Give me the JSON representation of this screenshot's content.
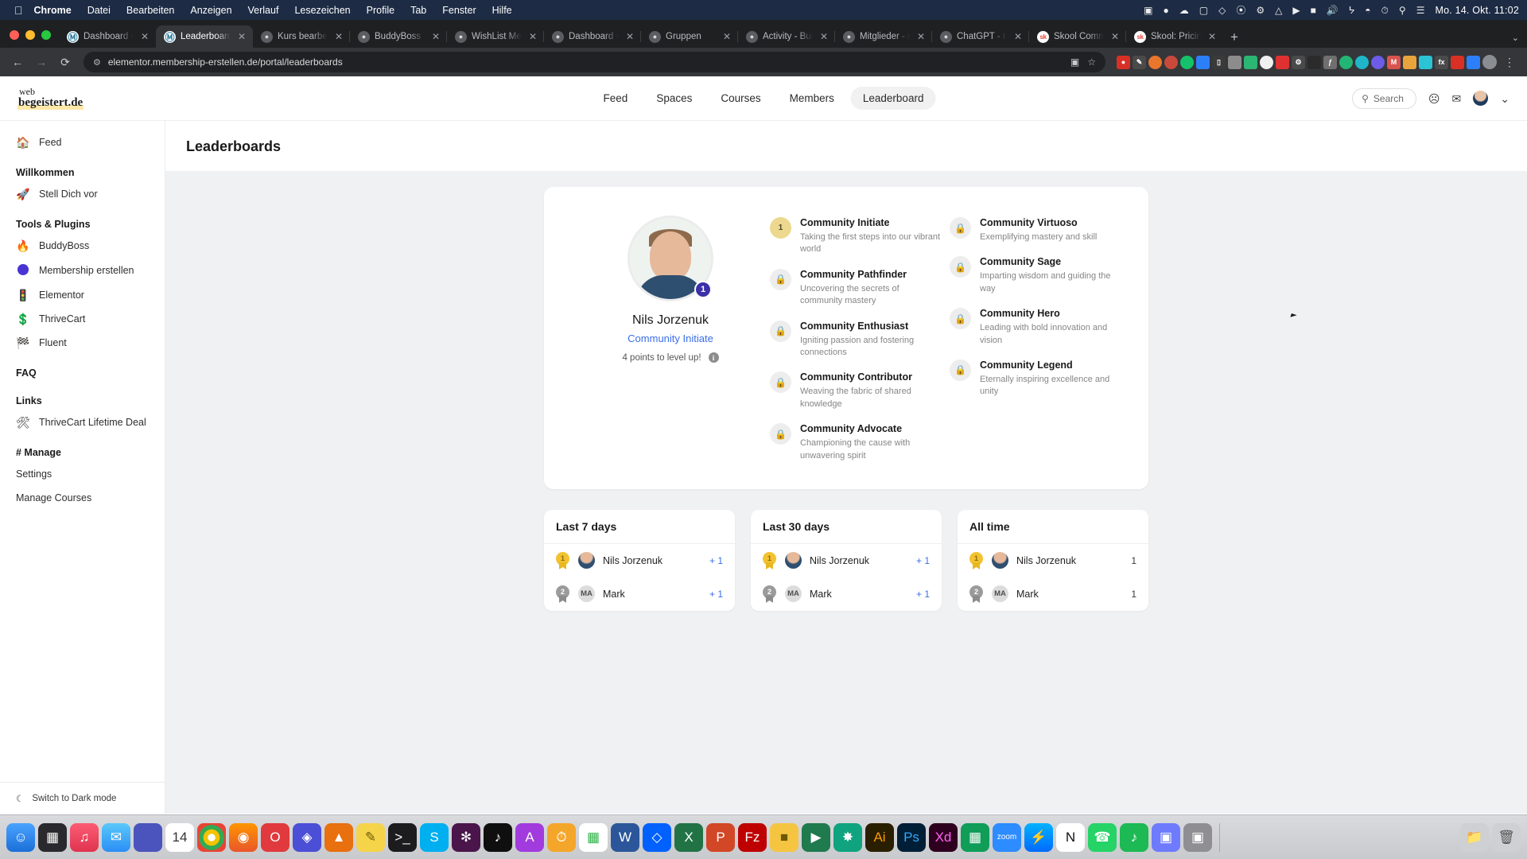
{
  "menubar": {
    "apple": "",
    "items": [
      {
        "label": "Chrome",
        "bold": true
      },
      {
        "label": "Datei",
        "bold": false
      },
      {
        "label": "Bearbeiten",
        "bold": false
      },
      {
        "label": "Anzeigen",
        "bold": false
      },
      {
        "label": "Verlauf",
        "bold": false
      },
      {
        "label": "Lesezeichen",
        "bold": false
      },
      {
        "label": "Profile",
        "bold": false
      },
      {
        "label": "Tab",
        "bold": false
      },
      {
        "label": "Fenster",
        "bold": false
      },
      {
        "label": "Hilfe",
        "bold": false
      }
    ],
    "status_icons": [
      "screen-record-icon",
      "cleanmymac-icon",
      "cloud-icon",
      "app-icon",
      "dropbox-icon",
      "grammarly-icon",
      "settings-gear-icon",
      "airdrop-icon",
      "play-icon",
      "battery-icon",
      "volume-icon",
      "bluetooth-icon",
      "wifi-icon",
      "time-machine-icon",
      "search-icon",
      "control-center-icon"
    ],
    "clock": "Mo. 14. Okt.  11:02"
  },
  "browser": {
    "tabs": [
      {
        "title": "Dashboard ‹ Fluent C",
        "favicon": "wp",
        "active": false
      },
      {
        "title": "Leaderboard - Fluent",
        "favicon": "wp",
        "active": true
      },
      {
        "title": "Kurs bearbeiten „Acti",
        "favicon": "generic",
        "active": false
      },
      {
        "title": "BuddyBoss Komponen",
        "favicon": "generic",
        "active": false
      },
      {
        "title": "WishList Member | Se",
        "favicon": "generic",
        "active": false
      },
      {
        "title": "Dashboard - member",
        "favicon": "generic",
        "active": false
      },
      {
        "title": "Gruppen",
        "favicon": "generic",
        "active": false
      },
      {
        "title": "Activity - BuddyBoss",
        "favicon": "generic",
        "active": false
      },
      {
        "title": "Mitglieder - members",
        "favicon": "generic",
        "active": false
      },
      {
        "title": "ChatGPT - membersh",
        "favicon": "generic",
        "active": false
      },
      {
        "title": "Skool Community",
        "favicon": "sk",
        "active": false
      },
      {
        "title": "Skool: Pricing",
        "favicon": "sk",
        "active": false
      }
    ],
    "new_tab_label": "+",
    "tab_list_chevron": "⌄",
    "url": "elementor.membership-erstellen.de/portal/leaderboards",
    "nav": {
      "back": "←",
      "forward": "→",
      "reload": "⟳"
    },
    "site_info_icon": "site-settings-icon",
    "omni_right": [
      "translate-icon",
      "bookmark-star-icon"
    ],
    "extensions": [
      "extension-red",
      "extension-pencil",
      "extension-orange",
      "extension-dark",
      "extension-grammarly",
      "extension-blue",
      "extension-monitor",
      "extension-gray",
      "extension-green",
      "extension-circle",
      "extension-red2",
      "extension-settings",
      "extension-dark2",
      "extension-puzzle",
      "extension-green2",
      "extension-teal",
      "extension-purple",
      "extension-m",
      "extension-yellow",
      "extension-cyan",
      "extension-fx",
      "extension-red3",
      "extension-new",
      "extension-blue2",
      "extension-profile",
      "extension-menu"
    ]
  },
  "app": {
    "brand": {
      "line1": "web",
      "line2": "begeistert.de"
    },
    "nav": [
      {
        "label": "Feed",
        "active": false
      },
      {
        "label": "Spaces",
        "active": false
      },
      {
        "label": "Courses",
        "active": false
      },
      {
        "label": "Members",
        "active": false
      },
      {
        "label": "Leaderboard",
        "active": true
      }
    ],
    "search_label": "Search",
    "header_icons": [
      "bell-icon",
      "mail-icon",
      "avatar",
      "chevron-down-icon"
    ],
    "page_title": "Leaderboards"
  },
  "sidebar": {
    "top": {
      "icon": "home-icon",
      "label": "Feed"
    },
    "sections": [
      {
        "heading": "Willkommen",
        "items": [
          {
            "emoji": "🚀",
            "label": "Stell Dich vor"
          }
        ]
      },
      {
        "heading": "Tools & Plugins",
        "items": [
          {
            "emoji": "🔥",
            "label": "BuddyBoss"
          },
          {
            "emoji": "ball",
            "label": "Membership erstellen"
          },
          {
            "emoji": "🚦",
            "label": "Elementor"
          },
          {
            "emoji": "💲",
            "label": "ThriveCart"
          },
          {
            "emoji": "🏁",
            "label": "Fluent"
          }
        ]
      },
      {
        "heading": "FAQ",
        "items": []
      },
      {
        "heading": "Links",
        "items": [
          {
            "emoji": "🛠",
            "label": "ThriveCart Lifetime Deal"
          }
        ]
      },
      {
        "heading": "# Manage",
        "plain": [
          "Settings",
          "Manage Courses"
        ]
      }
    ],
    "dark_mode": {
      "icon": "moon-icon",
      "label": "Switch to Dark mode"
    }
  },
  "profile": {
    "name": "Nils Jorzenuk",
    "rank": "Community Initiate",
    "level": "1",
    "points_text": "4 points to level up!",
    "info_icon": "info-icon"
  },
  "badges": {
    "left": [
      {
        "icon": "1",
        "unlocked": true,
        "title": "Community Initiate",
        "desc": "Taking the first steps into our vibrant world"
      },
      {
        "icon": "lock-icon",
        "unlocked": false,
        "title": "Community Pathfinder",
        "desc": "Uncovering the secrets of community mastery"
      },
      {
        "icon": "lock-icon",
        "unlocked": false,
        "title": "Community Enthusiast",
        "desc": "Igniting passion and fostering connections"
      },
      {
        "icon": "lock-icon",
        "unlocked": false,
        "title": "Community Contributor",
        "desc": "Weaving the fabric of shared knowledge"
      },
      {
        "icon": "lock-icon",
        "unlocked": false,
        "title": "Community Advocate",
        "desc": "Championing the cause with unwavering spirit"
      }
    ],
    "right": [
      {
        "icon": "lock-icon",
        "unlocked": false,
        "title": "Community Virtuoso",
        "desc": "Exemplifying mastery and skill"
      },
      {
        "icon": "lock-icon",
        "unlocked": false,
        "title": "Community Sage",
        "desc": "Imparting wisdom and guiding the way"
      },
      {
        "icon": "lock-icon",
        "unlocked": false,
        "title": "Community Hero",
        "desc": "Leading with bold innovation and vision"
      },
      {
        "icon": "lock-icon",
        "unlocked": false,
        "title": "Community Legend",
        "desc": "Eternally inspiring excellence and unity"
      }
    ]
  },
  "boards": [
    {
      "title": "Last 7 days",
      "rows": [
        {
          "rank": "1",
          "medal": "gold",
          "avatar": "photo",
          "name": "Nils Jorzenuk",
          "score": "+ 1",
          "score_style": "link"
        },
        {
          "rank": "2",
          "medal": "silver",
          "avatar": "MA",
          "name": "Mark",
          "score": "+ 1",
          "score_style": "link"
        }
      ]
    },
    {
      "title": "Last 30 days",
      "rows": [
        {
          "rank": "1",
          "medal": "gold",
          "avatar": "photo",
          "name": "Nils Jorzenuk",
          "score": "+ 1",
          "score_style": "link"
        },
        {
          "rank": "2",
          "medal": "silver",
          "avatar": "MA",
          "name": "Mark",
          "score": "+ 1",
          "score_style": "link"
        }
      ]
    },
    {
      "title": "All time",
      "rows": [
        {
          "rank": "1",
          "medal": "gold",
          "avatar": "photo",
          "name": "Nils Jorzenuk",
          "score": "1",
          "score_style": "plain"
        },
        {
          "rank": "2",
          "medal": "silver",
          "avatar": "MA",
          "name": "Mark",
          "score": "1",
          "score_style": "plain"
        }
      ]
    }
  ],
  "dock": {
    "icons": [
      "finder-icon",
      "launchpad-icon",
      "music-icon",
      "mail-icon",
      "teams-icon",
      "calendar-icon",
      "chrome-icon",
      "firefox-icon",
      "opera-icon",
      "brave-icon",
      "vlc-icon",
      "notes-icon",
      "terminal-icon",
      "skype-icon",
      "slack-icon",
      "tiktok-icon",
      "acrobat-icon",
      "clock-icon",
      "numbers-icon",
      "word-icon",
      "dropbox-icon",
      "excel-icon",
      "powerpoint-icon",
      "filezilla-icon",
      "keynote-icon",
      "camtasia-icon",
      "chatgpt-icon",
      "illustrator-icon",
      "photoshop-icon",
      "xd-icon",
      "sheets-icon",
      "zoom-icon",
      "messenger-icon",
      "notion-icon",
      "whatsapp-icon",
      "spotify-icon",
      "preview-icon",
      "screenshot-icon"
    ],
    "right_icons": [
      "downloads-folder-icon",
      "trash-icon"
    ]
  },
  "colors": {
    "accent_link": "#3a6ee8",
    "badge_gold": "#ecd88e",
    "level_badge": "#3b30a8",
    "canvas_bg": "#f0f1f3",
    "menubar_bg": "#1d2b44",
    "chrome_bg": "#35363a"
  }
}
